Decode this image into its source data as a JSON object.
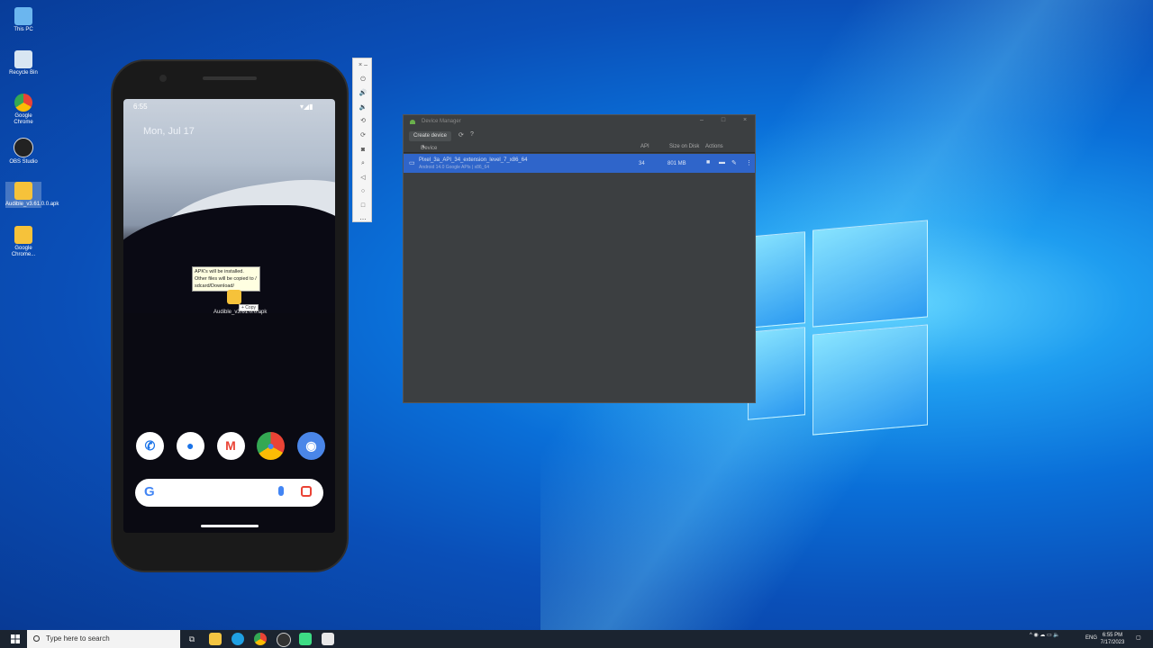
{
  "desktop_icons": [
    {
      "label": "This PC"
    },
    {
      "label": "Recycle Bin"
    },
    {
      "label": "Google Chrome"
    },
    {
      "label": "OBS Studio"
    },
    {
      "label": "Audible_v3.61.0.0.apk"
    },
    {
      "label": "Google Chrome..."
    }
  ],
  "phone": {
    "time": "6:55",
    "date": "Mon, Jul 17",
    "tooltip_lines": [
      "APK's will be installed.",
      "Other files will be copied to /",
      "sdcard/Download/"
    ],
    "drag_copy_label": "+ Copy",
    "drag_file_label": "Audible_v3.61.0.0.apk",
    "dock_apps": [
      "Phone",
      "Messages",
      "Gmail",
      "Chrome",
      "Camera"
    ],
    "search_logo": "G"
  },
  "emulator_toolbar": {
    "buttons": [
      "close-icon",
      "minimize-icon",
      "power-icon",
      "volume-up-icon",
      "volume-down-icon",
      "rotate-left-icon",
      "rotate-right-icon",
      "camera-icon",
      "zoom-icon",
      "back-icon",
      "home-icon",
      "overview-icon",
      "more-icon"
    ]
  },
  "device_manager": {
    "title": "Device Manager",
    "create_button": "Create device",
    "columns": {
      "device": "Device",
      "api": "API",
      "size": "Size on Disk",
      "actions": "Actions"
    },
    "rows": [
      {
        "name": "Pixel_3a_API_34_extension_level_7_x86_64",
        "subtitle": "Android 14.0 Google APIs | x86_64",
        "api": "34",
        "size": "801 MB"
      }
    ]
  },
  "taskbar": {
    "search_placeholder": "Type here to search",
    "language": "ENG",
    "time": "6:55 PM",
    "date": "7/17/2023"
  }
}
